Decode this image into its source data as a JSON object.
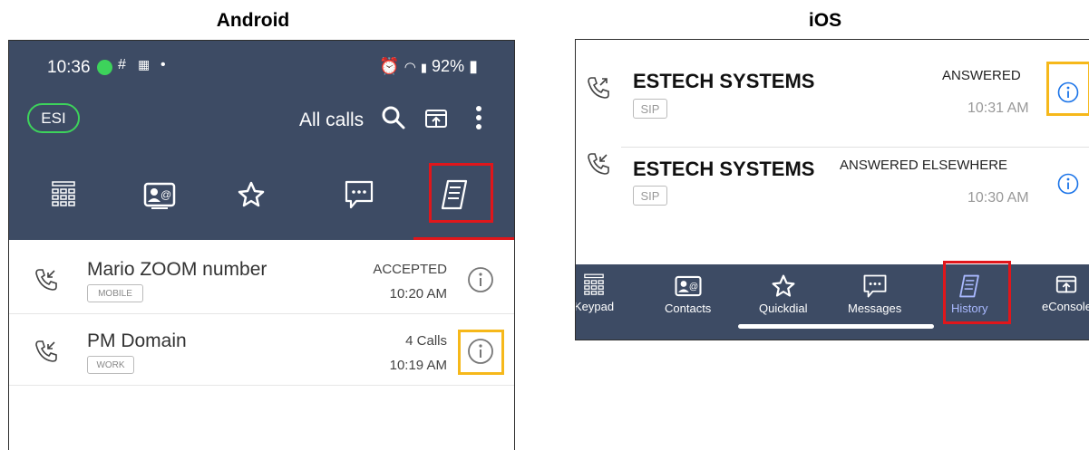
{
  "headings": {
    "android": "Android",
    "ios": "iOS"
  },
  "android": {
    "status_bar": {
      "time": "10:36",
      "battery": "92%"
    },
    "header": {
      "badge": "ESI",
      "filter_label": "All calls"
    },
    "tabs": [
      "keypad",
      "contacts",
      "quickdial",
      "messages",
      "history"
    ],
    "active_tab": "history",
    "calls": [
      {
        "name": "Mario ZOOM number",
        "tag": "MOBILE",
        "status": "ACCEPTED",
        "time": "10:20 AM",
        "direction": "incoming"
      },
      {
        "name": "PM Domain",
        "tag": "WORK",
        "status": "4 Calls",
        "time": "10:19 AM",
        "direction": "incoming"
      }
    ]
  },
  "ios": {
    "calls": [
      {
        "name": "ESTECH SYSTEMS",
        "tag": "SIP",
        "status": "ANSWERED",
        "time": "10:31 AM",
        "direction": "outgoing"
      },
      {
        "name": "ESTECH SYSTEMS",
        "tag": "SIP",
        "status": "ANSWERED ELSEWHERE",
        "time": "10:30 AM",
        "direction": "incoming"
      }
    ],
    "tabs": [
      {
        "label": "Keypad",
        "icon": "keypad-icon"
      },
      {
        "label": "Contacts",
        "icon": "contacts-icon"
      },
      {
        "label": "Quickdial",
        "icon": "star-icon"
      },
      {
        "label": "Messages",
        "icon": "messages-icon"
      },
      {
        "label": "History",
        "icon": "history-icon"
      },
      {
        "label": "eConsole",
        "icon": "econsole-icon"
      }
    ],
    "active_tab": "History"
  },
  "colors": {
    "header_bg": "#3d4b64",
    "highlight_red": "#e0161b",
    "highlight_yellow": "#f6b81a",
    "ios_accent": "#1a73e8",
    "esi_green": "#3dd35b"
  }
}
